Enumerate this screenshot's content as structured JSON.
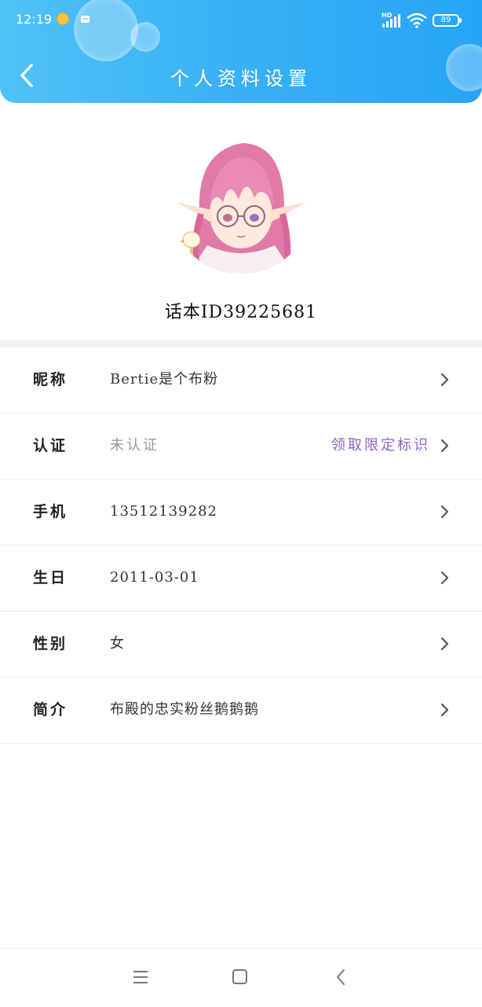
{
  "status_bar": {
    "time": "12:19",
    "network": "HD",
    "battery": "89"
  },
  "header": {
    "title": "个人资料设置",
    "back_icon": "chevron-left-icon"
  },
  "profile": {
    "user_id": "话本ID39225681",
    "avatar": "avatar-image"
  },
  "settings": {
    "items": [
      {
        "label": "昵称",
        "value": "Bertie是个布粉"
      },
      {
        "label": "认证",
        "value": "未认证",
        "link": "领取限定标识"
      },
      {
        "label": "手机",
        "value": "13512139282"
      },
      {
        "label": "生日",
        "value": "2011-03-01"
      },
      {
        "label": "性别",
        "value": "女"
      },
      {
        "label": "简介",
        "value": "布殿的忠实粉丝鹅鹅鹅"
      }
    ]
  },
  "nav_bar": {
    "icons": [
      "menu-icon",
      "home-icon",
      "back-icon"
    ]
  },
  "colors": {
    "header_gradient_start": "#4fc2f6",
    "header_gradient_end": "#27a4f6",
    "link_purple": "#8f63c5",
    "muted_text": "#9a9a9a"
  }
}
